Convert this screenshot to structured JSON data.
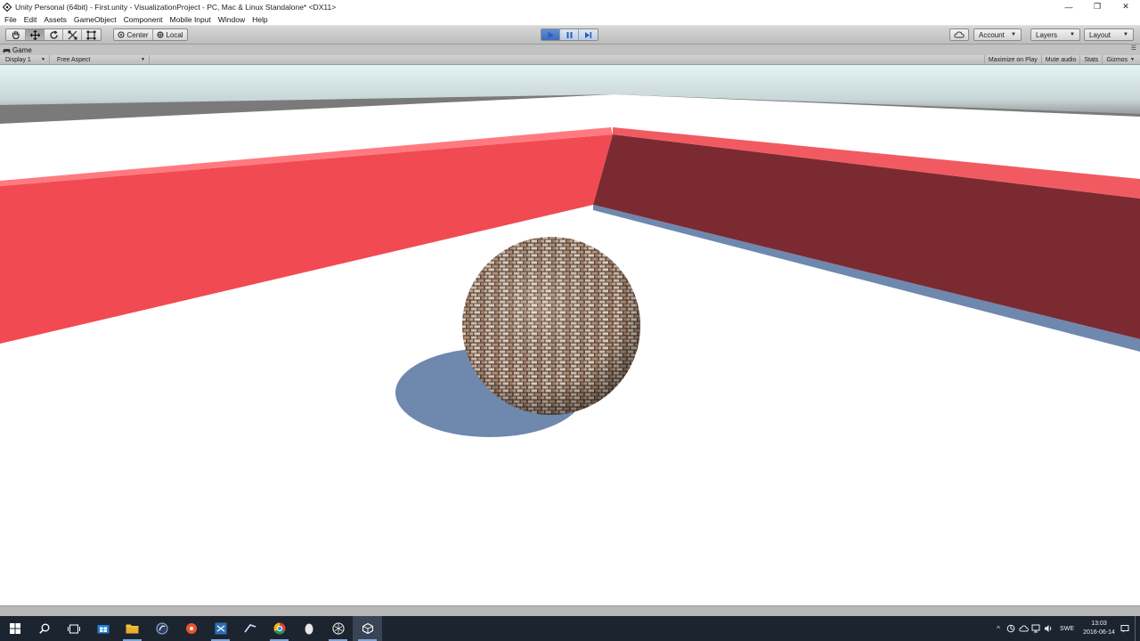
{
  "window": {
    "title": "Unity Personal (64bit) - First.unity - VisualizationProject - PC, Mac & Linux Standalone* <DX11>",
    "controls": {
      "minimize": "—",
      "restore": "❐",
      "close": "✕"
    }
  },
  "menu": {
    "items": [
      "File",
      "Edit",
      "Assets",
      "GameObject",
      "Component",
      "Mobile Input",
      "Window",
      "Help"
    ]
  },
  "toolbar": {
    "transform_tools": [
      "hand-icon",
      "move-icon",
      "rotate-icon",
      "scale-icon",
      "rect-icon"
    ],
    "pivot": {
      "center_label": "Center",
      "local_label": "Local"
    },
    "play_controls": [
      "play-icon",
      "pause-icon",
      "step-icon"
    ],
    "account_label": "Account",
    "layers_label": "Layers",
    "layout_label": "Layout"
  },
  "game_view": {
    "tab_label": "Game",
    "display_label": "Display 1",
    "aspect_label": "Free Aspect",
    "buttons": [
      "Maximize on Play",
      "Mute audio",
      "Stats",
      "Gizmos"
    ]
  },
  "scene": {
    "colors": {
      "sky_top": "#e0f2f4",
      "horizon": "#6e6e6e",
      "floor": "#ffffff",
      "wall_lit": "#f04a52",
      "wall_top": "#ff6e74",
      "wall_shadow": "#7a2a30",
      "shadow": "#6e88ae",
      "ball": "#8b6a55"
    }
  },
  "taskbar": {
    "language": "SWE",
    "time": "13:03",
    "date": "2016-06-14"
  }
}
